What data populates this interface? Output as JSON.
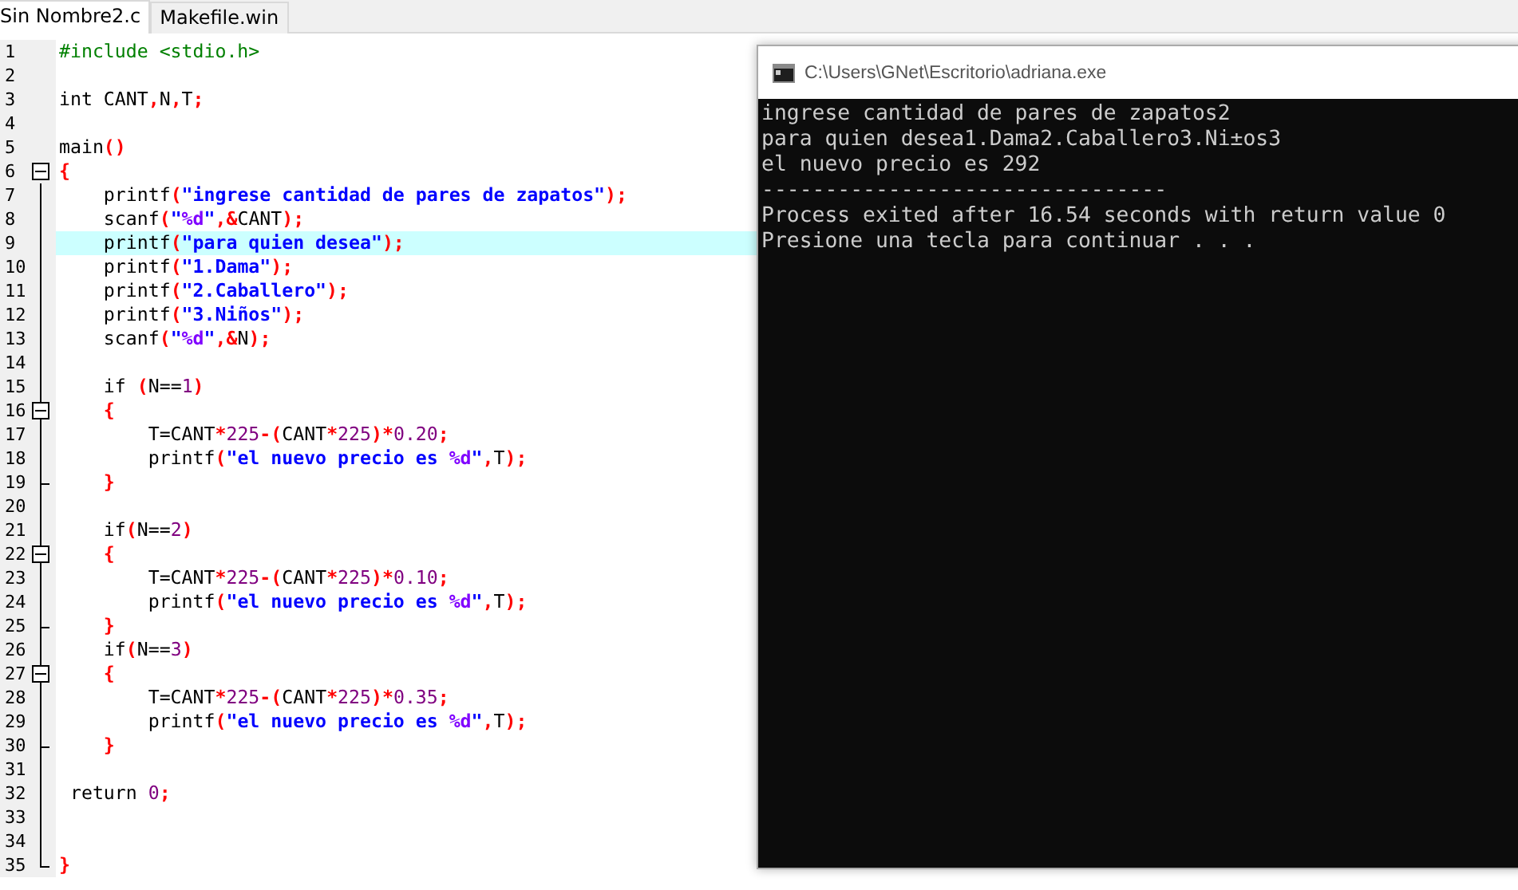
{
  "tabs": [
    {
      "label": "Sin Nombre2.c",
      "selected": true
    },
    {
      "label": "Makefile.win",
      "selected": false
    }
  ],
  "editor": {
    "lines": [
      {
        "n": "1",
        "text": "#include <stdio.h>",
        "kind": "plain",
        "current": false
      },
      {
        "n": "2",
        "kind": "plain",
        "current": false
      },
      {
        "n": "3",
        "text": "int CANT,N,T;",
        "kind": "plain",
        "current": false
      },
      {
        "n": "4",
        "kind": "plain",
        "current": false
      },
      {
        "n": "5",
        "text": "main()",
        "kind": "plain",
        "current": false
      },
      {
        "n": "6",
        "text": "{",
        "kind": "fold-start",
        "current": false
      },
      {
        "n": "7",
        "text": "    printf(\"ingrese cantidad de pares de zapatos\");",
        "kind": "plain",
        "current": false
      },
      {
        "n": "8",
        "text": "    scanf(\"%d\",&CANT);",
        "kind": "plain",
        "current": false
      },
      {
        "n": "9",
        "text": "    printf(\"para quien desea\");",
        "kind": "plain",
        "current": true
      },
      {
        "n": "10",
        "text": "    printf(\"1.Dama\");",
        "kind": "plain",
        "current": false
      },
      {
        "n": "11",
        "text": "    printf(\"2.Caballero\");",
        "kind": "plain",
        "current": false
      },
      {
        "n": "12",
        "text": "    printf(\"3.Niños\");",
        "kind": "plain",
        "current": false
      },
      {
        "n": "13",
        "text": "    scanf(\"%d\",&N);",
        "kind": "plain",
        "current": false
      },
      {
        "n": "14",
        "kind": "plain",
        "current": false
      },
      {
        "n": "15",
        "text": "    if (N==1)",
        "kind": "plain",
        "current": false
      },
      {
        "n": "16",
        "text": "    {",
        "kind": "fold-start",
        "current": false
      },
      {
        "n": "17",
        "text": "        T=CANT*225-(CANT*225)*0.20;",
        "kind": "plain",
        "current": false
      },
      {
        "n": "18",
        "text": "        printf(\"el nuevo precio es %d\",T);",
        "kind": "plain",
        "current": false
      },
      {
        "n": "19",
        "text": "    }",
        "kind": "fold-end",
        "current": false
      },
      {
        "n": "20",
        "kind": "plain",
        "current": false
      },
      {
        "n": "21",
        "text": "    if(N==2)",
        "kind": "plain",
        "current": false
      },
      {
        "n": "22",
        "text": "    {",
        "kind": "fold-start",
        "current": false
      },
      {
        "n": "23",
        "text": "        T=CANT*225-(CANT*225)*0.10;",
        "kind": "plain",
        "current": false
      },
      {
        "n": "24",
        "text": "        printf(\"el nuevo precio es %d\",T);",
        "kind": "plain",
        "current": false
      },
      {
        "n": "25",
        "text": "    }",
        "kind": "fold-end",
        "current": false
      },
      {
        "n": "26",
        "text": "    if(N==3)",
        "kind": "plain",
        "current": false
      },
      {
        "n": "27",
        "text": "    {",
        "kind": "fold-start",
        "current": false
      },
      {
        "n": "28",
        "text": "        T=CANT*225-(CANT*225)*0.35;",
        "kind": "plain",
        "current": false
      },
      {
        "n": "29",
        "text": "        printf(\"el nuevo precio es %d\",T);",
        "kind": "plain",
        "current": false
      },
      {
        "n": "30",
        "text": "    }",
        "kind": "fold-end",
        "current": false
      },
      {
        "n": "31",
        "kind": "plain",
        "current": false
      },
      {
        "n": "32",
        "text": " return 0;",
        "kind": "plain",
        "current": false
      },
      {
        "n": "33",
        "kind": "plain",
        "current": false
      },
      {
        "n": "34",
        "kind": "plain",
        "current": false
      },
      {
        "n": "35",
        "text": "}",
        "kind": "fold-end",
        "current": false
      }
    ]
  },
  "console": {
    "title": "C:\\Users\\GNet\\Escritorio\\adriana.exe",
    "lines": [
      "ingrese cantidad de pares de zapatos2",
      "para quien desea1.Dama2.Caballero3.Ni±os3",
      "el nuevo precio es 292",
      "--------------------------------",
      "Process exited after 16.54 seconds with return value 0",
      "Presione una tecla para continuar . . ."
    ]
  }
}
